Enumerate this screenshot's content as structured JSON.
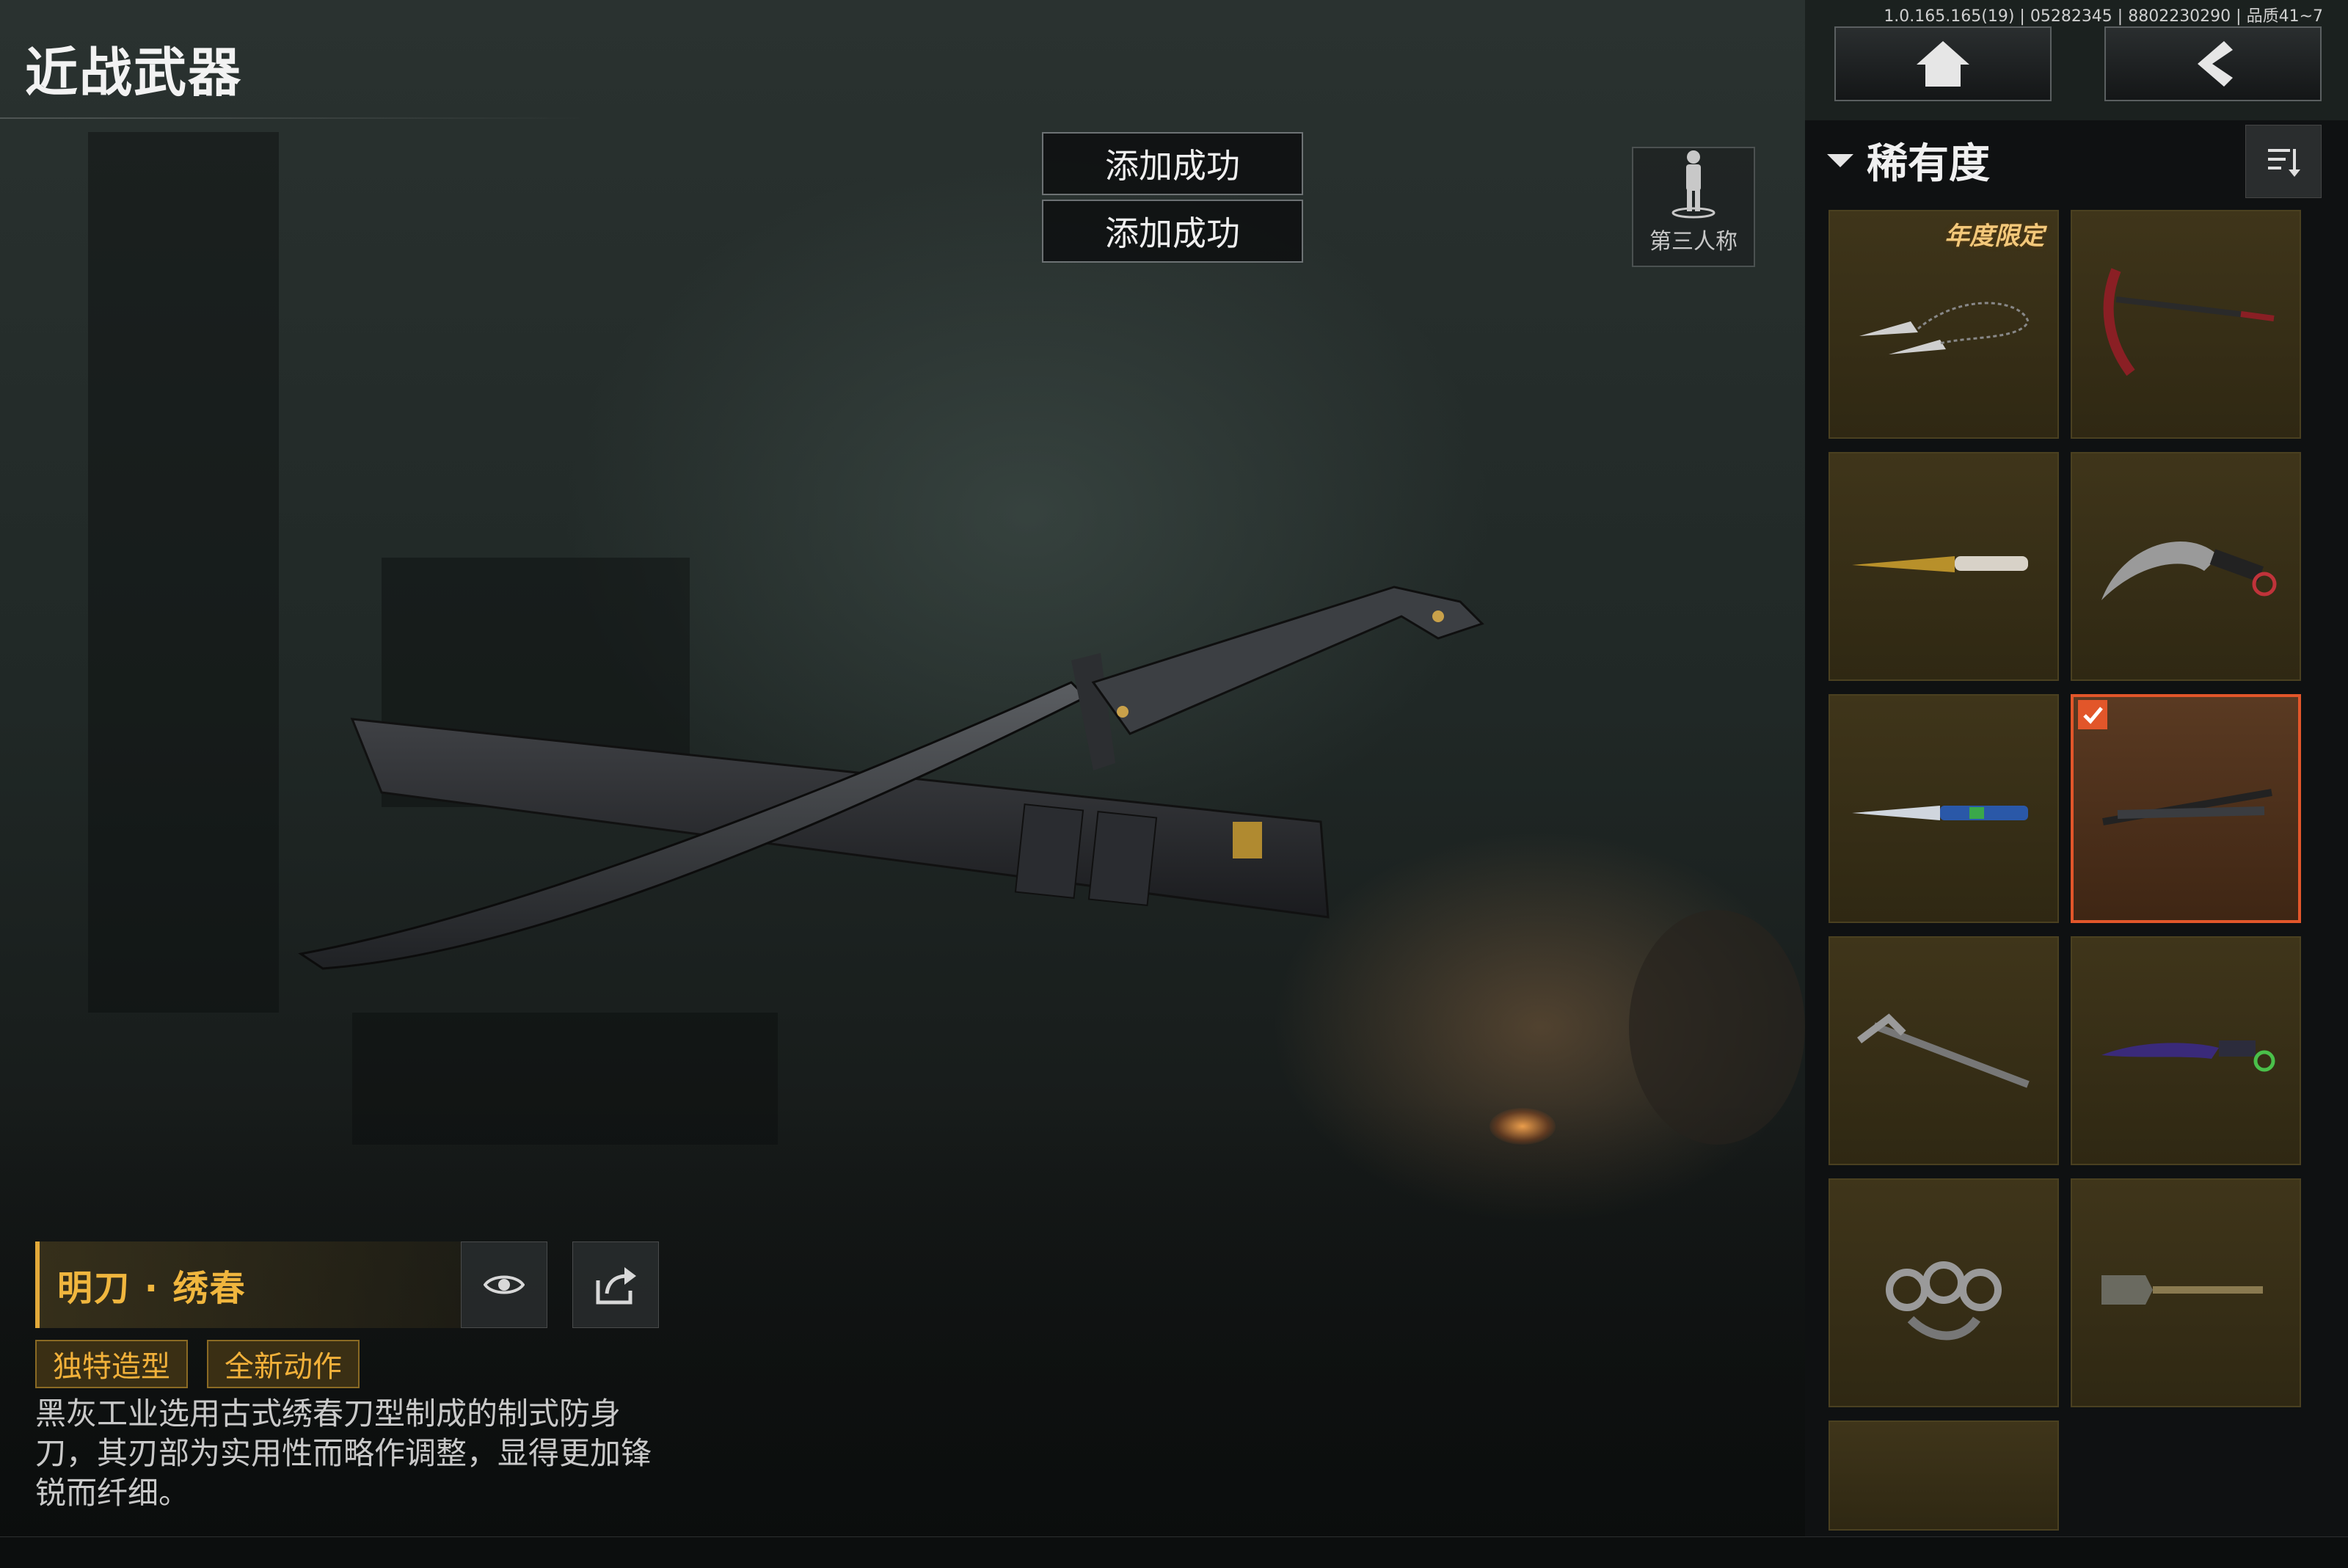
{
  "header": {
    "title": "近战武器",
    "version": "1.0.165.165(19) | 05282345 | 8802230290 | 品质41~7"
  },
  "nav": {
    "home": "home-icon",
    "back": "back-arrow-icon"
  },
  "toasts": [
    "添加成功",
    "添加成功"
  ],
  "view_toggle": {
    "label": "第三人称",
    "icon": "person-icon"
  },
  "weapon": {
    "name": "明刀 · 绣春",
    "tags": [
      "独特造型",
      "全新动作"
    ],
    "description": "黑灰工业选用古式绣春刀型制成的制式防身刀，其刃部为实用性而略作调整，显得更加锋锐而纤细。"
  },
  "sidebar": {
    "filter_label": "稀有度",
    "items": [
      {
        "name": "chain-kunai",
        "badge": "年度限定",
        "selected": false
      },
      {
        "name": "sickle",
        "badge": "",
        "selected": false
      },
      {
        "name": "gold-knife",
        "badge": "",
        "selected": false
      },
      {
        "name": "karambit",
        "badge": "",
        "selected": false
      },
      {
        "name": "blue-butterfly-knife",
        "badge": "",
        "selected": false
      },
      {
        "name": "xiuchun-blade",
        "badge": "",
        "selected": true
      },
      {
        "name": "ice-axe",
        "badge": "",
        "selected": false
      },
      {
        "name": "purple-karambit",
        "badge": "",
        "selected": false
      },
      {
        "name": "brass-knuckles",
        "badge": "",
        "selected": false
      },
      {
        "name": "shovel",
        "badge": "",
        "selected": false
      },
      {
        "name": "partial-item",
        "badge": "",
        "selected": false
      }
    ]
  },
  "colors": {
    "accent": "#f0b63e",
    "selected_border": "#e2562a",
    "cell_bg": "#3f351a"
  }
}
